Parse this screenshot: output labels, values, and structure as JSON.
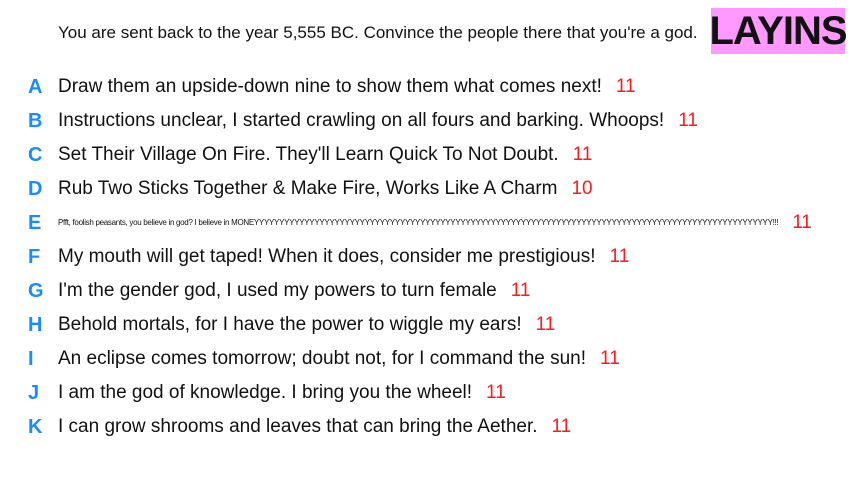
{
  "header": {
    "prompt": "You are sent back to the year 5,555 BC. Convince the people there that you're a god.",
    "logo_text": "LAYINS"
  },
  "colors": {
    "letter": "#1a8cff",
    "score": "#ff1a1a",
    "logo_bg": "#ff99ff"
  },
  "answers": [
    {
      "letter": "A",
      "text": "Draw them an upside-down nine to show them what comes next!",
      "score": "11"
    },
    {
      "letter": "B",
      "text": "Instructions unclear, I started crawling on all fours and barking. Whoops!",
      "score": "11"
    },
    {
      "letter": "C",
      "text": "Set Their Village On Fire. They'll Learn Quick To Not Doubt.",
      "score": "11"
    },
    {
      "letter": "D",
      "text": "Rub Two Sticks Together & Make Fire, Works Like A Charm",
      "score": "10"
    },
    {
      "letter": "E",
      "text": "Pfft, foolish peasants, you believe in god? I believe in MONEYYYYYYYYYYYYYYYYYYYYYYYYYYYYYYYYYYYYYYYYYYYYYYYYYYYYYYYYYYYYYYYYYYYYYYYYYYYYYYYYYYYYYYYYYYYYYYYYYYYYYYY!!!",
      "score": "11"
    },
    {
      "letter": "F",
      "text": "My mouth will get taped! When it does, consider me prestigious!",
      "score": "11"
    },
    {
      "letter": "G",
      "text": "I'm the gender god, I used my powers to turn female",
      "score": "11"
    },
    {
      "letter": "H",
      "text": "Behold mortals, for I have the power to wiggle my ears!",
      "score": "11"
    },
    {
      "letter": "I",
      "text": "An eclipse comes tomorrow; doubt not, for I command the sun!",
      "score": "11"
    },
    {
      "letter": "J",
      "text": "I am the god of knowledge. I bring you the wheel!",
      "score": "11"
    },
    {
      "letter": "K",
      "text": "I can grow shrooms and leaves that can bring the Aether.",
      "score": "11"
    }
  ]
}
